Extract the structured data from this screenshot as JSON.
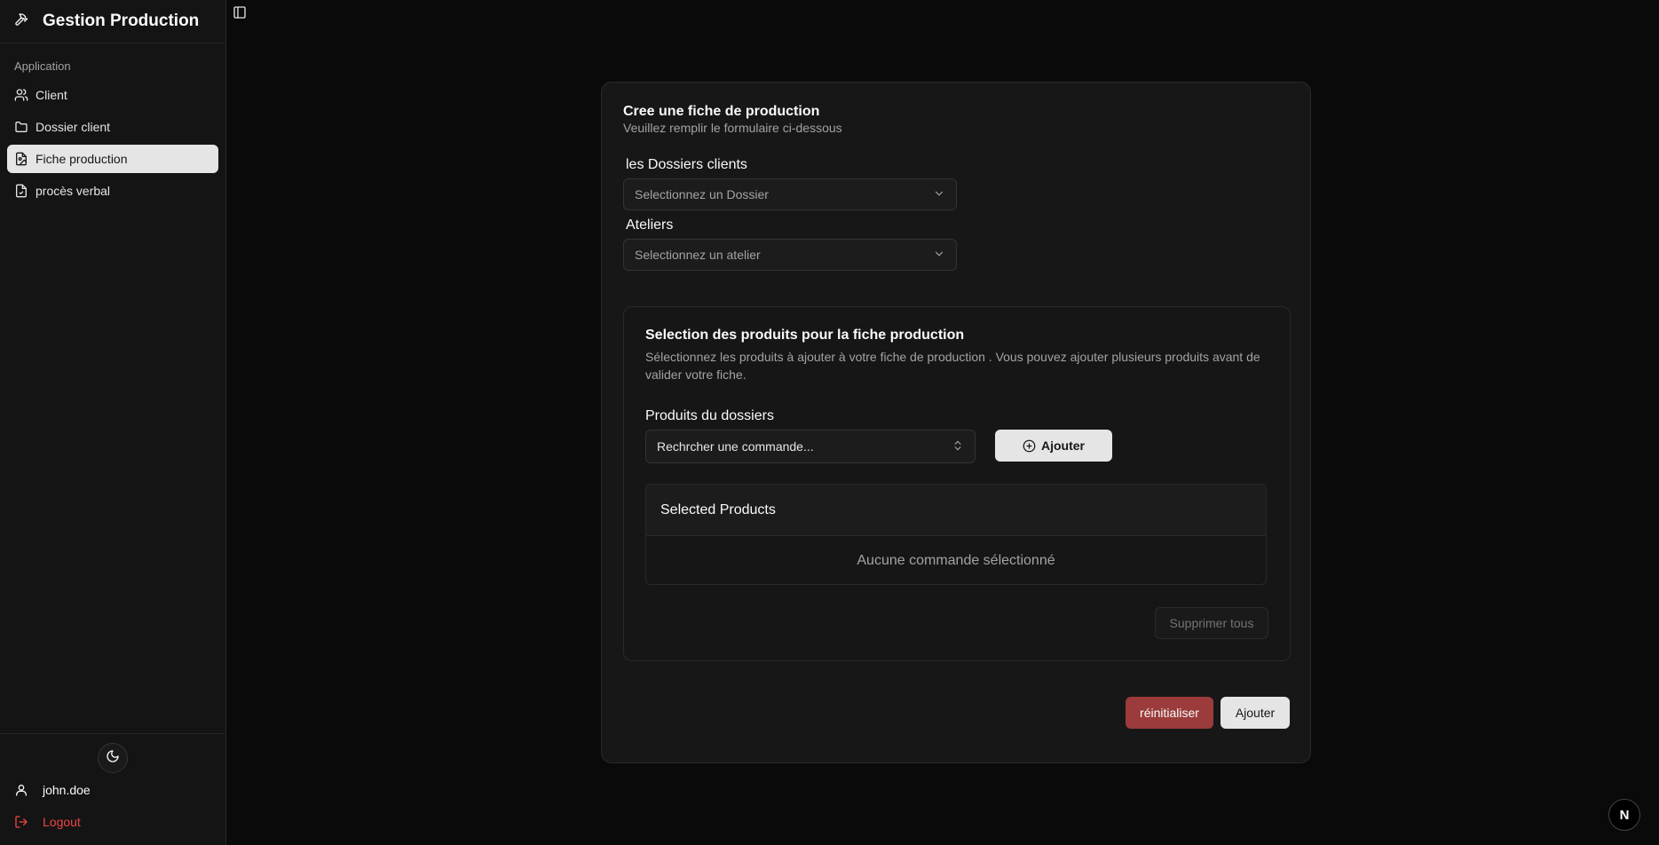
{
  "app": {
    "title": "Gestion Production"
  },
  "sidebar": {
    "section_label": "Application",
    "items": [
      {
        "label": "Client",
        "icon": "users-icon",
        "active": false
      },
      {
        "label": "Dossier client",
        "icon": "folder-icon",
        "active": false
      },
      {
        "label": "Fiche production",
        "icon": "file-image-icon",
        "active": true
      },
      {
        "label": "procès verbal",
        "icon": "file-check-icon",
        "active": false
      }
    ],
    "user": {
      "name": "john.doe"
    },
    "logout_label": "Logout"
  },
  "form": {
    "title": "Cree une fiche de production",
    "subtitle": "Veuillez remplir le formulaire ci-dessous",
    "dossier": {
      "label": "les Dossiers clients",
      "placeholder": "Selectionnez un Dossier"
    },
    "atelier": {
      "label": "Ateliers",
      "placeholder": "Selectionnez un atelier"
    },
    "products": {
      "title": "Selection des produits pour la fiche production",
      "description": "Sélectionnez les produits à ajouter à votre fiche de production . Vous pouvez ajouter plusieurs produits avant de valider votre fiche.",
      "label": "Produits du dossiers",
      "search_placeholder": "Rechrcher une commande...",
      "add_label": "Ajouter",
      "table_header": "Selected Products",
      "empty_text": "Aucune commande sélectionné",
      "delete_all_label": "Supprimer tous"
    },
    "reset_label": "réinitialiser",
    "submit_label": "Ajouter"
  },
  "badge": {
    "letter": "N"
  },
  "colors": {
    "accent_danger": "#9b3b3b",
    "logout": "#ef4444",
    "background": "#0a0a0a"
  }
}
